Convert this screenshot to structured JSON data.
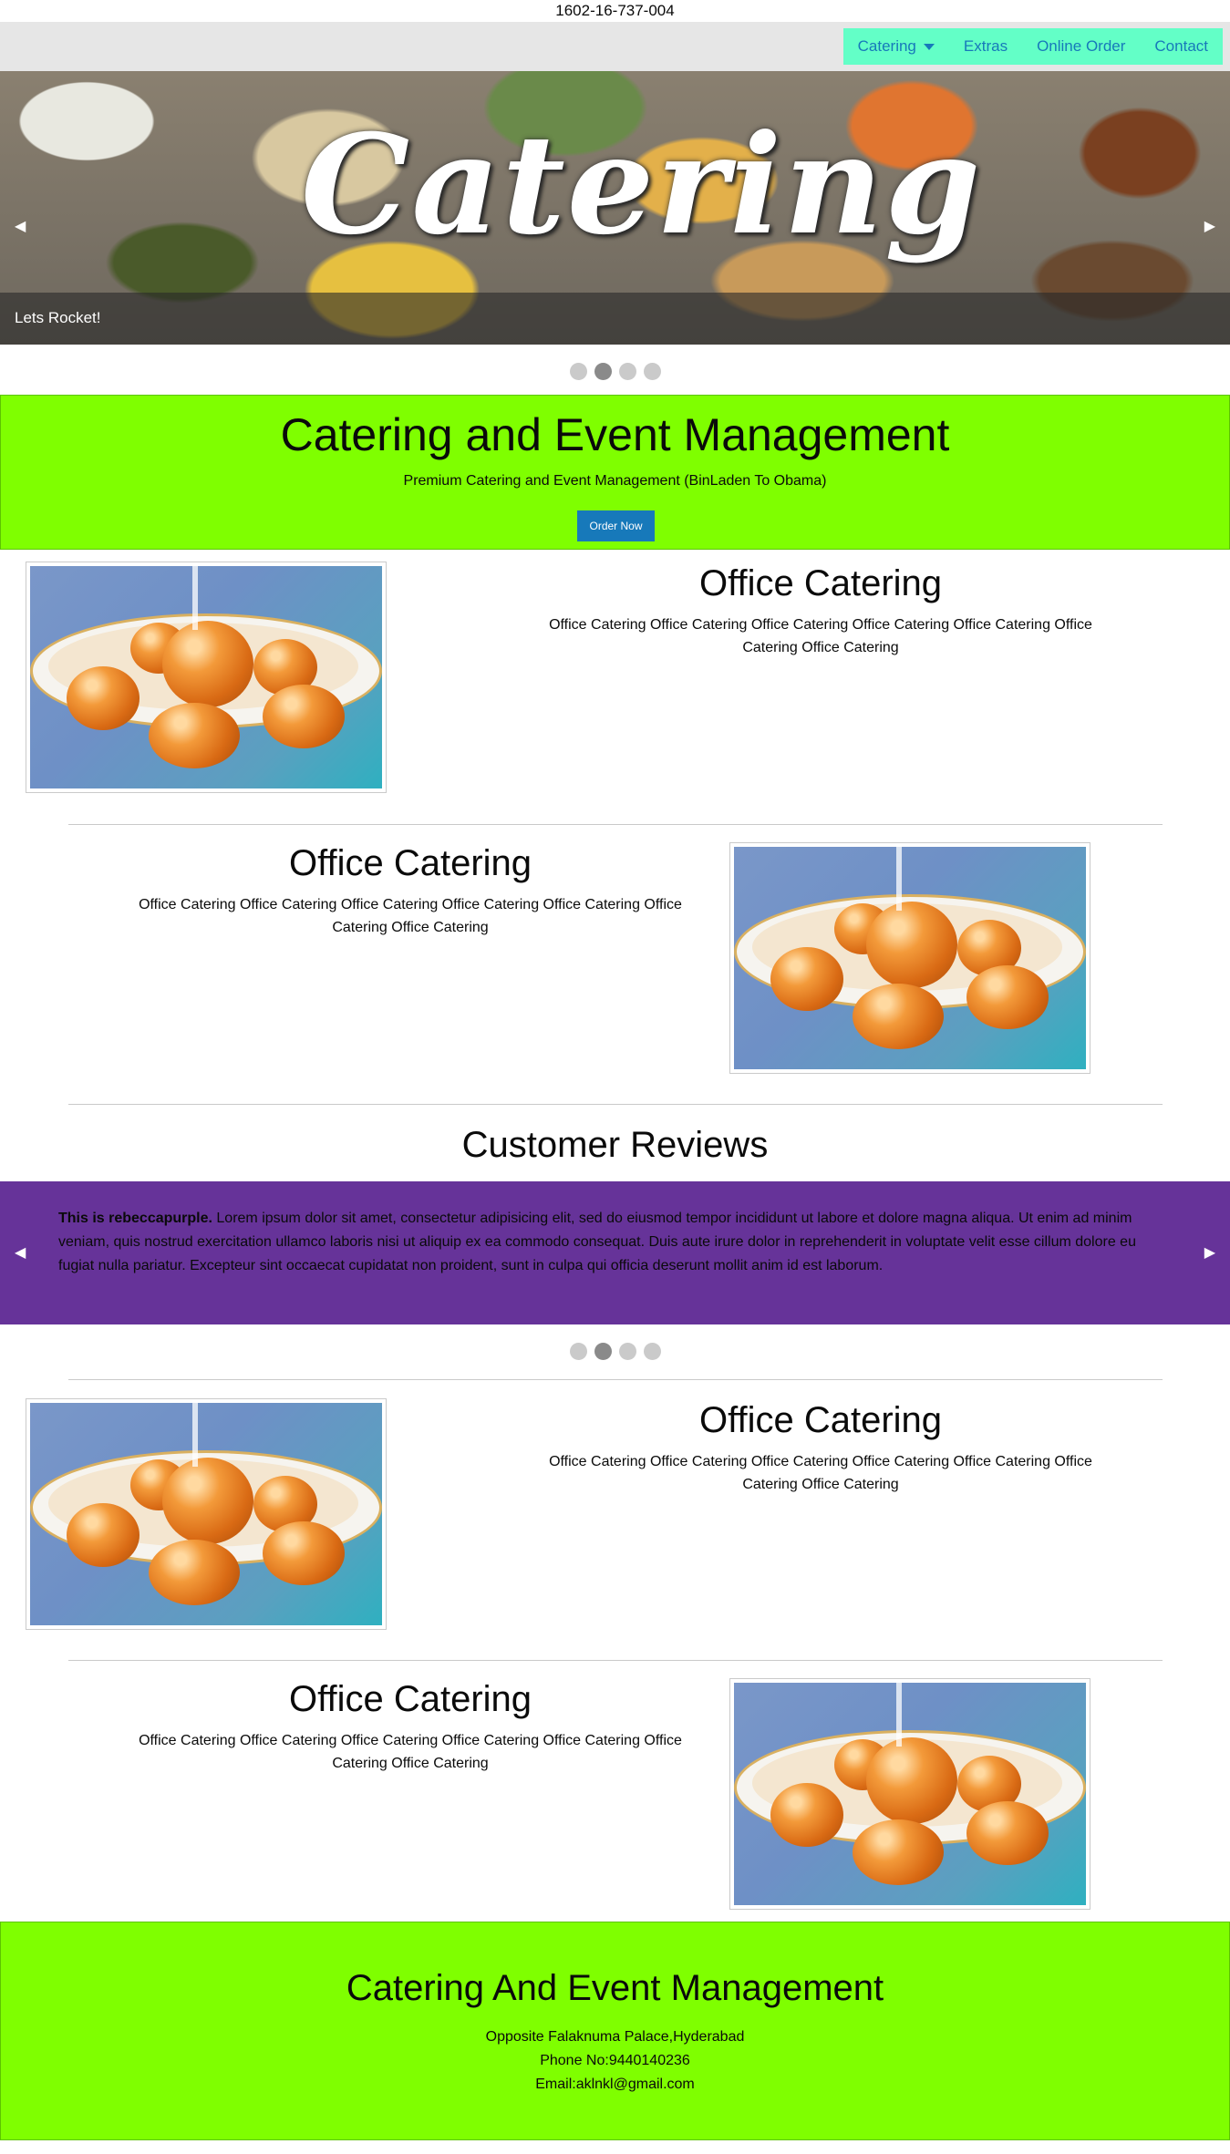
{
  "phone": "1602-16-737-004",
  "nav": {
    "items": [
      "Catering",
      "Extras",
      "Online Order",
      "Contact"
    ]
  },
  "hero": {
    "script_text": "Catering",
    "caption": "Lets Rocket!",
    "prev": "◀",
    "next": "▶"
  },
  "banner": {
    "title": "Catering and Event Management",
    "subtitle": "Premium Catering and Event Management (BinLaden To Obama)",
    "button": "Order Now"
  },
  "features": [
    {
      "title": "Office Catering",
      "text": "Office Catering Office Catering Office Catering Office Catering Office Catering Office Catering Office Catering"
    },
    {
      "title": "Office Catering",
      "text": "Office Catering Office Catering Office Catering Office Catering Office Catering Office Catering Office Catering"
    },
    {
      "title": "Office Catering",
      "text": "Office Catering Office Catering Office Catering Office Catering Office Catering Office Catering Office Catering"
    },
    {
      "title": "Office Catering",
      "text": "Office Catering Office Catering Office Catering Office Catering Office Catering Office Catering Office Catering"
    }
  ],
  "reviews": {
    "heading": "Customer Reviews",
    "bold": "This is rebeccapurple.",
    "text": " Lorem ipsum dolor sit amet, consectetur adipisicing elit, sed do eiusmod tempor incididunt ut labore et dolore magna aliqua. Ut enim ad minim veniam, quis nostrud exercitation ullamco laboris nisi ut aliquip ex ea commodo consequat. Duis aute irure dolor in reprehenderit in voluptate velit esse cillum dolore eu fugiat nulla pariatur. Excepteur sint occaecat cupidatat non proident, sunt in culpa qui officia deserunt mollit anim id est laborum."
  },
  "footer": {
    "title": "Catering And Event Management",
    "address": "Opposite Falaknuma Palace,Hyderabad",
    "phone": "Phone No:9440140236",
    "email": "Email:aklnkl@gmail.com"
  },
  "colors": {
    "accent": "#1779ba",
    "green": "#7fff00",
    "menu": "#63ffc7",
    "purple": "#663399"
  }
}
